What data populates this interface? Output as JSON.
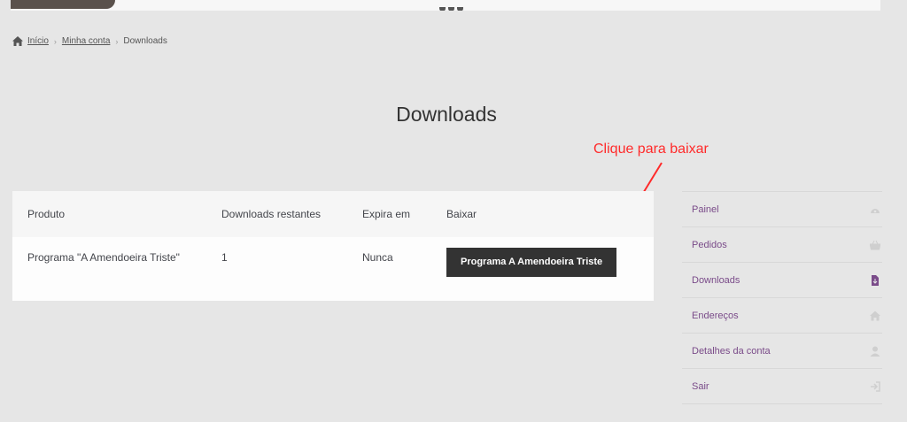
{
  "breadcrumb": {
    "home": "Início",
    "account": "Minha conta",
    "current": "Downloads"
  },
  "page": {
    "title": "Downloads"
  },
  "annotation": {
    "text": "Clique para baixar",
    "color": "#ff2a2a"
  },
  "table": {
    "headers": [
      "Produto",
      "Downloads restantes",
      "Expira em",
      "Baixar"
    ],
    "rows": [
      {
        "product": "Programa \"A Amendoeira Triste\"",
        "remaining": "1",
        "expires": "Nunca",
        "download_label": "Programa A Amendoeira Triste"
      }
    ]
  },
  "nav": {
    "items": [
      {
        "label": "Painel",
        "icon": "dashboard-icon"
      },
      {
        "label": "Pedidos",
        "icon": "basket-icon"
      },
      {
        "label": "Downloads",
        "icon": "file-icon",
        "active": true
      },
      {
        "label": "Endereços",
        "icon": "home-icon"
      },
      {
        "label": "Detalhes da conta",
        "icon": "user-icon"
      },
      {
        "label": "Sair",
        "icon": "logout-icon"
      }
    ]
  },
  "colors": {
    "link": "#7a4b89",
    "button": "#333333",
    "background": "#e6e6e6"
  }
}
